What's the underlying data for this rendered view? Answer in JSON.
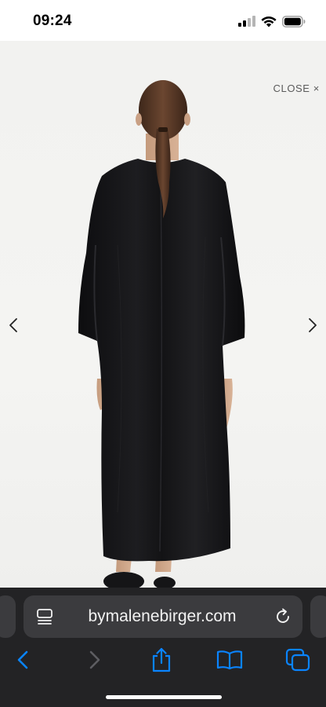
{
  "status_bar": {
    "time": "09:24",
    "icons": [
      "signal-icon",
      "wifi-icon",
      "battery-icon"
    ]
  },
  "gallery": {
    "close_label": "CLOSE",
    "close_glyph": "×",
    "photo_description_icon": "product-photo",
    "prev_icon": "chevron-left-icon",
    "next_icon": "chevron-right-icon"
  },
  "browser": {
    "url": "bymalenebirger.com",
    "reader_icon": "page-menu-icon",
    "reload_icon": "reload-icon",
    "toolbar": [
      "back-icon",
      "forward-icon",
      "share-icon",
      "bookmarks-icon",
      "tabs-icon"
    ]
  },
  "colors": {
    "accent": "#0a84ff",
    "chrome_bg": "#232325",
    "field_bg": "#3b3b3e",
    "dress": "#141416"
  }
}
